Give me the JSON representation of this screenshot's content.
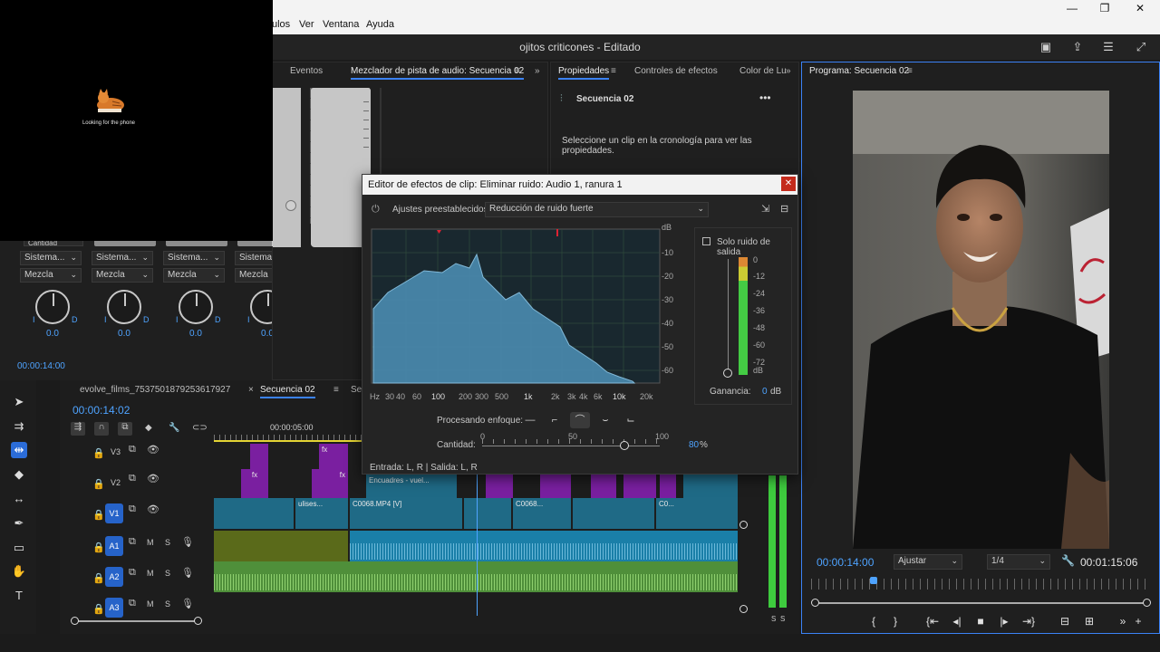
{
  "menu": {
    "items": [
      "ulos",
      "Ver",
      "Ventana",
      "Ayuda"
    ]
  },
  "window": {
    "minimize": "—",
    "restore": "❐",
    "close": "✕"
  },
  "app": {
    "title": "ojitos criticones - Editado"
  },
  "overlay": {
    "caption": "Looking for the phone"
  },
  "audio_mixer": {
    "tabs": [
      "Eventos",
      "Mezclador de pista de audio: Secuencia 02"
    ],
    "cantidad_label": "Cantidad",
    "channels": [
      {
        "routing": "Sistema...",
        "mode": "Mezcla",
        "value": "0.0"
      },
      {
        "routing": "Sistema...",
        "mode": "Mezcla",
        "value": "0.0"
      },
      {
        "routing": "Sistema...",
        "mode": "Mezcla",
        "value": "0.0"
      },
      {
        "routing": "Sistema...",
        "mode": "Mezcla",
        "value": "0.0"
      }
    ],
    "knob_left": "I",
    "knob_right": "D",
    "time": "00:00:14:00"
  },
  "properties": {
    "tabs": [
      "Propiedades",
      "Controles de efectos",
      "Color de Lu"
    ],
    "sequence": "Secuencia 02",
    "message": "Seleccione un clip en la cronología para ver las propiedades."
  },
  "program": {
    "tab": "Programa: Secuencia 02",
    "timecode": "00:00:14:00",
    "fit": "Ajustar",
    "quality": "1/4",
    "duration": "00:01:15:06"
  },
  "timeline": {
    "tabs": [
      "evolve_films_7537501879253617927",
      "Secuencia 02",
      "Sec"
    ],
    "timecode": "00:00:14:02",
    "ruler_time": "00:00:05:00",
    "tracks": [
      {
        "id": "V3"
      },
      {
        "id": "V2"
      },
      {
        "id": "V1"
      },
      {
        "id": "A1",
        "m": "M",
        "s": "S"
      },
      {
        "id": "A2",
        "m": "M",
        "s": "S"
      },
      {
        "id": "A3",
        "m": "M",
        "s": "S"
      }
    ],
    "v1_clips": [
      "ulises...",
      "C0068.MP4 [V]",
      "C0068...",
      "C0..."
    ],
    "v2_clip_label": "Encuadres - vuel...",
    "fx": "fx",
    "meter_labels": [
      "S",
      "S"
    ]
  },
  "fx_dialog": {
    "title": "Editor de efectos de clip: Eliminar ruido: Audio 1, ranura 1",
    "close": "✕",
    "presets_label": "Ajustes preestablecidos:",
    "preset_value": "Reducción de ruido fuerte",
    "db_unit": "dB",
    "y_ticks": [
      "-10",
      "-20",
      "-30",
      "-40",
      "-50",
      "-60"
    ],
    "x_ticks": [
      "Hz",
      "30",
      "40",
      "60",
      "100",
      "200",
      "300",
      "500",
      "1k",
      "2k",
      "3k",
      "4k",
      "6k",
      "10k",
      "20k"
    ],
    "output_noise_only": "Solo ruido de salida",
    "vu_ticks": [
      "0",
      "-12",
      "-24",
      "-36",
      "-48",
      "-60",
      "-72",
      "dB"
    ],
    "gain_label": "Ganancia:",
    "gain_value": "0",
    "gain_unit": "dB",
    "focus_label": "Procesando enfoque:",
    "amount_label": "Cantidad:",
    "amount_ticks": [
      "0",
      "50",
      "100"
    ],
    "amount_value": "80",
    "amount_unit": "%",
    "amount_fraction": 0.8,
    "io": "Entrada: L, R | Salida: L, R"
  },
  "colors": {
    "accent": "#3b82f6",
    "video_clip": "#1f6a86",
    "title_clip": "#7a1fa0",
    "audio_clip": "#1a7fa8",
    "audio2_clip": "#4f8f3a"
  }
}
